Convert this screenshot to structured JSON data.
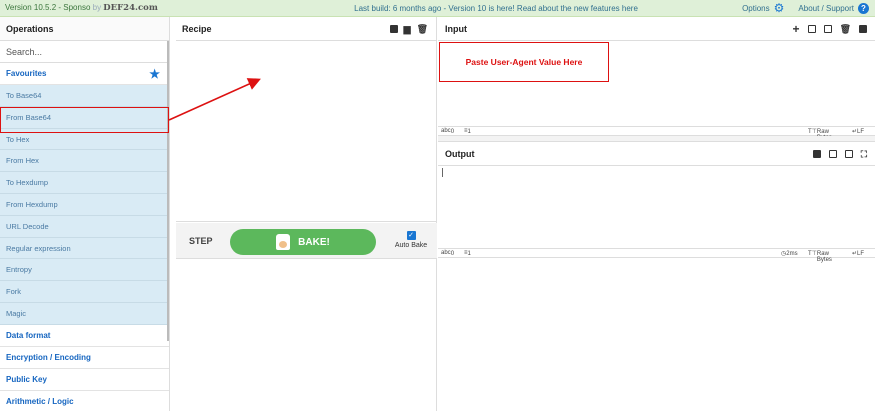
{
  "banner": {
    "version_text": "Version 10.5.2 - Sponso",
    "brand": "DEF24.com",
    "build_notice": "Last build: 6 months ago - Version 10 is here! Read about the new features here",
    "options": "Options",
    "about": "About / Support"
  },
  "operations": {
    "title": "Operations",
    "search_placeholder": "Search...",
    "favourites_label": "Favourites",
    "favourites": [
      "To Base64",
      "From Base64",
      "To Hex",
      "From Hex",
      "To Hexdump",
      "From Hexdump",
      "URL Decode",
      "Regular expression",
      "Entropy",
      "Fork",
      "Magic"
    ],
    "categories": [
      "Data format",
      "Encryption / Encoding",
      "Public Key",
      "Arithmetic / Logic"
    ]
  },
  "recipe": {
    "title": "Recipe",
    "step_label": "STEP",
    "bake_label": "BAKE!",
    "auto_bake_label": "Auto Bake"
  },
  "input": {
    "title": "Input",
    "length": "0",
    "lines": "1",
    "raw_bytes": "Raw Bytes",
    "eol": "LF"
  },
  "output": {
    "title": "Output",
    "length": "0",
    "lines": "1",
    "time": "2ms",
    "raw_bytes": "Raw Bytes",
    "eol": "LF"
  },
  "annotation": {
    "paste_hint": "Paste User-Agent Value Here",
    "color": "#dd1111"
  }
}
